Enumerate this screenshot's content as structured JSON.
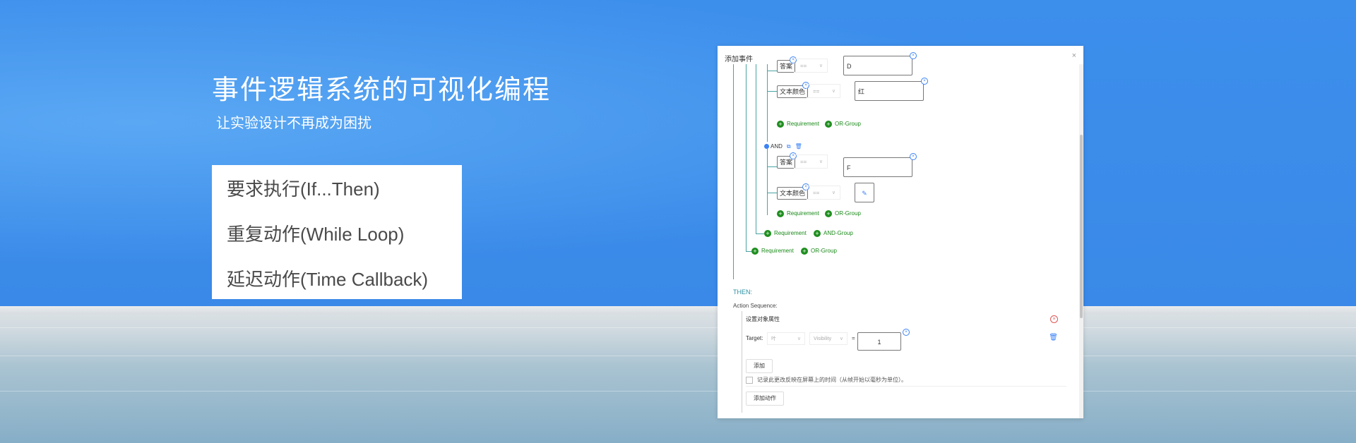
{
  "hero": {
    "title": "事件逻辑系统的可视化编程",
    "subtitle": "让实验设计不再成为困扰"
  },
  "features": [
    "要求执行(If...Then)",
    "重复动作(While Loop)",
    "延迟动作(Time Callback)"
  ],
  "dialog": {
    "title": "添加事件",
    "close": "×",
    "conditions": {
      "group1": [
        {
          "tag": "答案",
          "op": "==",
          "value": "D"
        },
        {
          "tag": "文本颜色",
          "op": "==",
          "value": "红"
        }
      ],
      "group1_add_requirement": "Requirement",
      "group1_add_or": "OR-Group",
      "and_label": "AND",
      "group2": [
        {
          "tag": "答案",
          "op": "==",
          "value": "F"
        },
        {
          "tag": "文本颜色",
          "op": "==",
          "value": ""
        }
      ],
      "group2_add_requirement": "Requirement",
      "group2_add_or": "OR-Group",
      "outer_add_requirement": "Requirement",
      "outer_add_and": "AND-Group",
      "root_add_requirement": "Requirement",
      "root_add_or": "OR-Group"
    },
    "then_label": "THEN:",
    "action_sequence_label": "Action Sequence:",
    "action": {
      "title": "设置对象属性",
      "target_label": "Target:",
      "target_value": "叶",
      "property_value": "Visibility",
      "equals": "=",
      "value": "1",
      "add_button": "添加",
      "record_checkbox_label": "记录此更改反映在屏幕上的时间（从帧开始以毫秒为单位）。",
      "add_action_button": "添加动作"
    }
  },
  "colors": {
    "green": "#1e8e1e",
    "teal": "#4aa3a3",
    "blue": "#3b82f6",
    "red": "#e05555"
  }
}
